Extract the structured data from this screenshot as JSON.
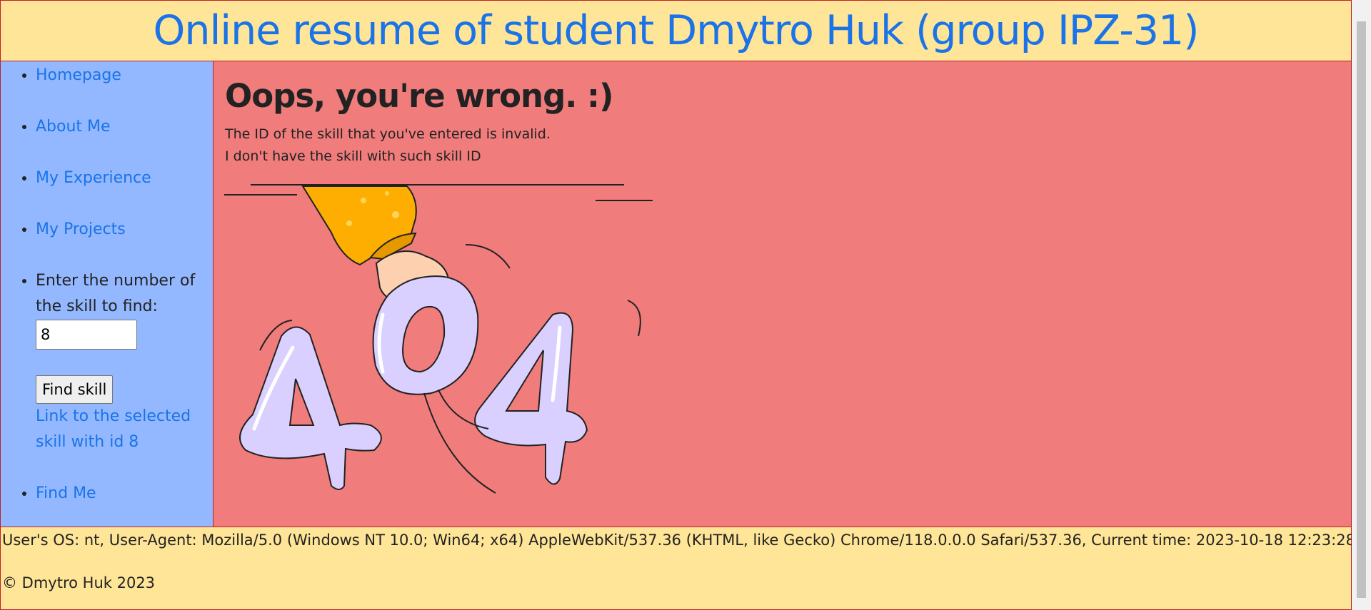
{
  "header": {
    "title": "Online resume of student Dmytro Huk (group IPZ-31)"
  },
  "sidebar": {
    "items": [
      {
        "label": "Homepage"
      },
      {
        "label": "About Me"
      },
      {
        "label": "My Experience"
      },
      {
        "label": "My Projects"
      }
    ],
    "search": {
      "prompt": "Enter the number of the skill to find:",
      "value": "8",
      "button_label": "Find skill",
      "link_text": "Link to the selected skill with id 8"
    },
    "find_me": "Find Me"
  },
  "main": {
    "heading": "Oops, you're wrong. :)",
    "line1": "The ID of the skill that you've entered is invalid.",
    "line2": "I don't have the skill with such skill ID",
    "illustration_text": "404"
  },
  "footer": {
    "sysinfo": "User's OS: nt, User-Agent: Mozilla/5.0 (Windows NT 10.0; Win64; x64) AppleWebKit/537.36 (KHTML, like Gecko) Chrome/118.0.0.0 Safari/537.36, Current time: 2023-10-18 12:23:28",
    "copyright": "© Dmytro Huk 2023"
  },
  "colors": {
    "header_bg": "#ffe597",
    "sidebar_bg": "#93b8ff",
    "main_bg": "#f07c7c",
    "link": "#1a73e8",
    "border": "#c0202a"
  }
}
